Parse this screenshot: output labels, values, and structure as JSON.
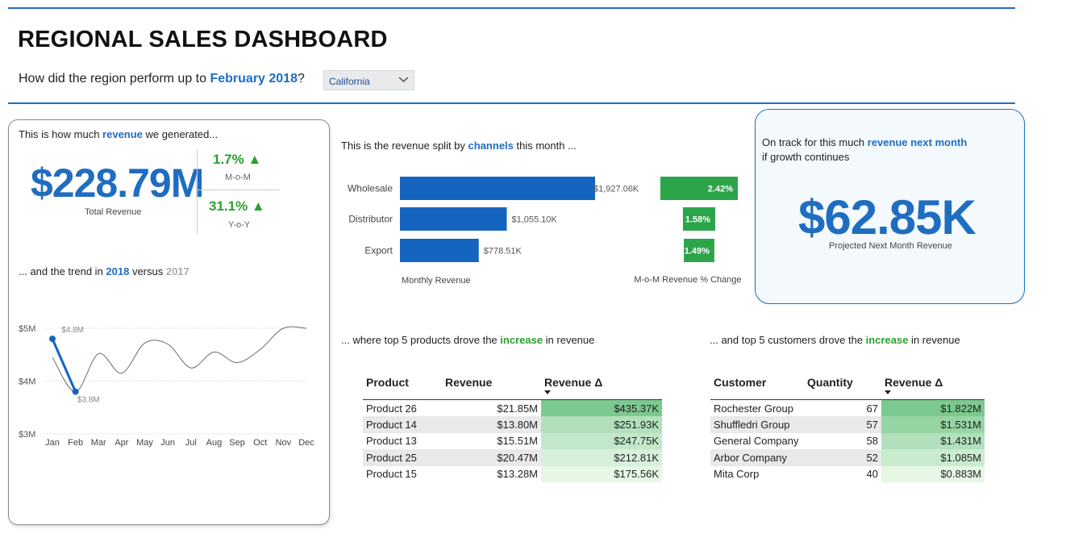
{
  "header": {
    "title": "REGIONAL SALES DASHBOARD",
    "question_prefix": "How did the region perform up to ",
    "question_highlight": "February 2018",
    "question_suffix": "?",
    "region_select": "California"
  },
  "revenue_card": {
    "intro_prefix": "This is how much ",
    "intro_highlight": "revenue",
    "intro_suffix": " we generated...",
    "total_value": "$228.79M",
    "total_label": "Total Revenue",
    "mom_value": "1.7% ▲",
    "mom_label": "M-o-M",
    "yoy_value": "31.1% ▲",
    "yoy_label": "Y-o-Y",
    "trend_prefix": "... and the trend in ",
    "trend_year_current": "2018",
    "trend_mid": " versus ",
    "trend_year_prior": "2017"
  },
  "channels": {
    "intro_prefix": "This is the revenue split by ",
    "intro_highlight": "channels",
    "intro_suffix": " this month ...",
    "xlabel_left": "Monthly Revenue",
    "xlabel_right": "M-o-M Revenue % Change"
  },
  "projection": {
    "intro_prefix": "On track for this much ",
    "intro_highlight": "revenue next month",
    "intro_line2": "if growth continues",
    "value": "$62.85K",
    "label": "Projected Next Month Revenue"
  },
  "products": {
    "intro_prefix": "... where top 5 products drove the ",
    "intro_highlight": "increase",
    "intro_suffix": " in revenue",
    "columns": [
      "Product",
      "Revenue",
      "Revenue Δ"
    ],
    "rows": [
      [
        "Product 26",
        "$21.85M",
        "$435.37K"
      ],
      [
        "Product 14",
        "$13.80M",
        "$251.93K"
      ],
      [
        "Product 13",
        "$15.51M",
        "$247.75K"
      ],
      [
        "Product 25",
        "$20.47M",
        "$212.81K"
      ],
      [
        "Product 15",
        "$13.28M",
        "$175.56K"
      ]
    ],
    "delta_colors": [
      "#7cc98f",
      "#b2e0bd",
      "#c3e8c9",
      "#d6f0d9",
      "#e6f7e5"
    ]
  },
  "customers": {
    "intro_prefix": "... and top 5 customers drove the ",
    "intro_highlight": "increase",
    "intro_suffix": " in revenue",
    "columns": [
      "Customer",
      "Quantity",
      "Revenue Δ"
    ],
    "rows": [
      [
        "Rochester Group",
        "67",
        "$1.822M"
      ],
      [
        "Shuffledri Group",
        "57",
        "$1.531M"
      ],
      [
        "General Company",
        "58",
        "$1.431M"
      ],
      [
        "Arbor Company",
        "52",
        "$1.085M"
      ],
      [
        "Mita Corp",
        "40",
        "$0.883M"
      ]
    ],
    "delta_colors": [
      "#7cc98f",
      "#97d4a4",
      "#b2e0bd",
      "#c9eccf",
      "#e6f7e5"
    ]
  },
  "chart_data": [
    {
      "type": "bar",
      "orientation": "horizontal",
      "categories": [
        "Wholesale",
        "Distributor",
        "Export"
      ],
      "values": [
        1927.06,
        1055.1,
        778.51
      ],
      "value_labels": [
        "$1,927.06K",
        "$1,055.10K",
        "$778.51K"
      ],
      "xlabel": "Monthly Revenue",
      "color": "#1565c0"
    },
    {
      "type": "bar",
      "orientation": "horizontal",
      "categories": [
        "Wholesale",
        "Distributor",
        "Export"
      ],
      "values": [
        2.42,
        1.58,
        1.49
      ],
      "value_labels": [
        "2.42%",
        "1.58%",
        "1.49%"
      ],
      "xlabel": "M-o-M Revenue % Change",
      "color": "#2ca54a"
    },
    {
      "type": "line",
      "categories": [
        "Jan",
        "Feb",
        "Mar",
        "Apr",
        "May",
        "Jun",
        "Jul",
        "Aug",
        "Sep",
        "Oct",
        "Nov",
        "Dec"
      ],
      "yticks": [
        "$3M",
        "$4M",
        "$5M"
      ],
      "ylim": [
        3.0,
        5.0
      ],
      "series": [
        {
          "name": "2017",
          "values": [
            4.45,
            3.8,
            4.52,
            4.15,
            4.72,
            4.7,
            4.25,
            4.55,
            4.35,
            4.6,
            5.0,
            5.0
          ],
          "color": "#6b6b6b"
        },
        {
          "name": "2018",
          "values": [
            4.8,
            3.8
          ],
          "color": "#1565c0"
        }
      ],
      "point_labels": [
        "$4.8M",
        "$3.8M"
      ]
    }
  ]
}
